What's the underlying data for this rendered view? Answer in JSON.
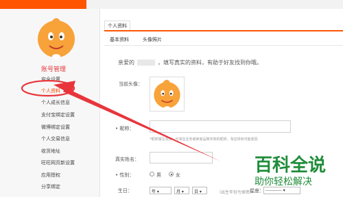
{
  "sidebar": {
    "title": "账号管理",
    "items": [
      {
        "label": "安全设置"
      },
      {
        "label": "个人资料"
      },
      {
        "label": "个人成长信息"
      },
      {
        "label": "支付宝绑定设置"
      },
      {
        "label": "微博绑定设置"
      },
      {
        "label": "个人交易信息"
      },
      {
        "label": "收货地址"
      },
      {
        "label": "旺旺网页新设置"
      },
      {
        "label": "应用授权"
      },
      {
        "label": "分享绑定"
      }
    ]
  },
  "main": {
    "tab": "个人资料",
    "subtabs": [
      "基本资料",
      "头像照片"
    ],
    "greeting_prefix": "亲爱的",
    "greeting_suffix": "，填写真实的资料，有助于好友找到你哦。",
    "avatar_label": "当前头像：",
    "nickname_label": "昵称：",
    "nickname_hint": "*昵称填写须知：与淘宝业务或卖家品牌冲突的昵称，淘宝将有可能收回",
    "realname_label": "真实姓名：",
    "gender_label": "性别：",
    "gender_options": [
      "男",
      "女"
    ],
    "birthday_label": "生日：",
    "year_placeholder": "年",
    "month_placeholder": "月",
    "day_placeholder": "日",
    "birthday_hint": "（出生年份为保密）",
    "constellation_label": "星座：",
    "constellation_placeholder": "-----------"
  },
  "watermark": {
    "title": "百科全说",
    "subtitle": "助你轻松解决"
  },
  "colors": {
    "accent": "#ff5500",
    "active_link": "#ff4400",
    "title_red": "#e4393c",
    "arrow": "#e8353b",
    "watermark": "#1f8d3a"
  }
}
